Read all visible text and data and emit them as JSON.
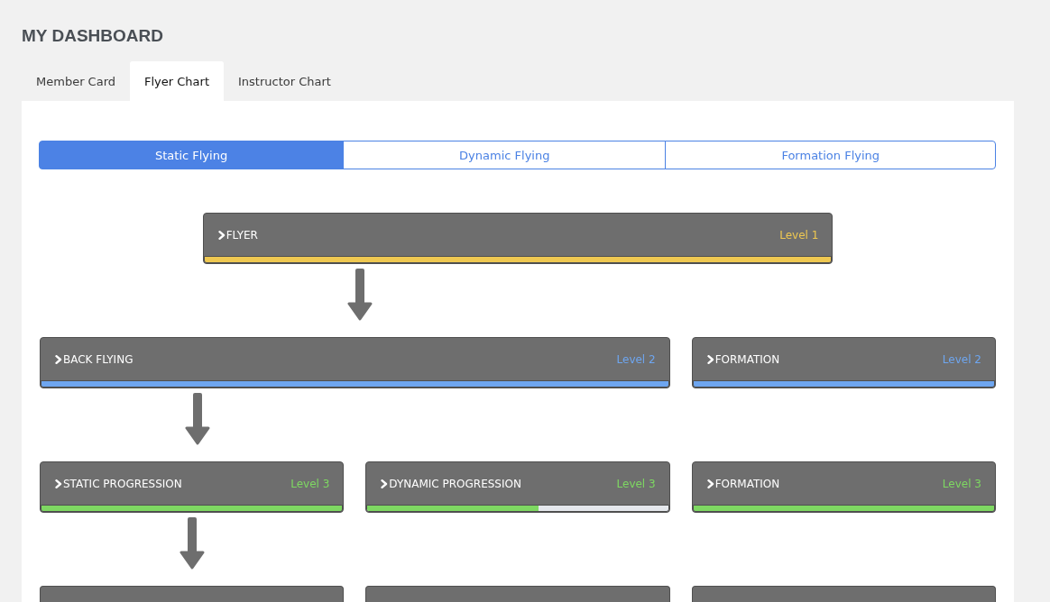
{
  "title": "MY DASHBOARD",
  "tabs": [
    {
      "label": "Member Card",
      "selected": false
    },
    {
      "label": "Flyer Chart",
      "selected": true
    },
    {
      "label": "Instructor Chart",
      "selected": false
    }
  ],
  "segments": [
    {
      "label": "Static Flying",
      "selected": true
    },
    {
      "label": "Dynamic Flying",
      "selected": false
    },
    {
      "label": "Formation Flying",
      "selected": false
    }
  ],
  "chart_rows": [
    {
      "nodes": [
        {
          "kind": "wide",
          "title": "FLYER",
          "level_label": "Level 1",
          "color": "#efc851",
          "level": 1,
          "arrow_below": true
        }
      ]
    },
    {
      "nodes": [
        {
          "kind": "wide",
          "title": "BACK FLYING",
          "level_label": "Level 2",
          "color": "#6ea6f0",
          "level": 1,
          "arrow_below": true
        },
        {
          "kind": "narrow",
          "title": "FORMATION",
          "level_label": "Level 2",
          "color": "#6ea6f0",
          "level": 1,
          "arrow_below": false
        }
      ]
    },
    {
      "nodes": [
        {
          "kind": "narrow",
          "title": "STATIC PROGRESSION",
          "level_label": "Level 3",
          "color": "#7ed862",
          "level": 1,
          "arrow_below": true
        },
        {
          "kind": "narrow",
          "title": "DYNAMIC PROGRESSION",
          "level_label": "Level 3",
          "color": "#7ed862",
          "level": 0.57,
          "arrow_below": false
        },
        {
          "kind": "narrow",
          "title": "FORMATION",
          "level_label": "Level 3",
          "color": "#7ed862",
          "level": 1,
          "arrow_below": false
        }
      ]
    },
    {
      "nodes": [
        {
          "kind": "partial"
        },
        {
          "kind": "partial"
        },
        {
          "kind": "partial"
        }
      ]
    }
  ]
}
